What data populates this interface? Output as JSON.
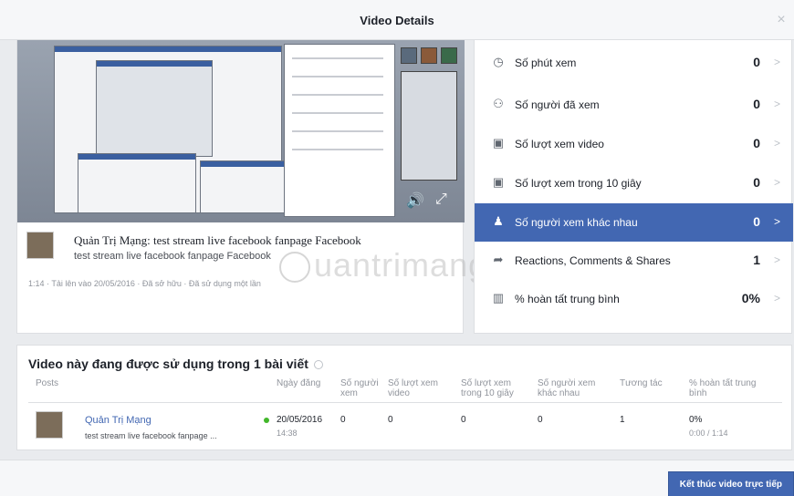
{
  "dialog": {
    "title": "Video Details",
    "close_glyph": "×"
  },
  "video": {
    "title": "Quản Trị Mạng: test stream live facebook fanpage Facebook",
    "description": "test stream live facebook fanpage Facebook",
    "meta": "1:14 · Tải lên vào 20/05/2016 · Đã sở hữu · Đã sử dụng một lần"
  },
  "watermark": "uantrimang",
  "metrics": [
    {
      "icon": "clock-icon",
      "glyph": "◷",
      "label": "Số phút xem",
      "value": "0",
      "active": false
    },
    {
      "icon": "people-icon",
      "glyph": "⚇",
      "label": "Số người đã xem",
      "value": "0",
      "active": false
    },
    {
      "icon": "video-views-icon",
      "glyph": "▣",
      "label": "Số lượt xem video",
      "value": "0",
      "active": false
    },
    {
      "icon": "video-10s-icon",
      "glyph": "▣",
      "label": "Số lượt xem trong 10 giây",
      "value": "0",
      "active": false
    },
    {
      "icon": "person-icon",
      "glyph": "♟",
      "label": "Số người xem khác nhau",
      "value": "0",
      "active": true
    },
    {
      "icon": "share-icon",
      "glyph": "➦",
      "label": "Reactions, Comments & Shares",
      "value": "1",
      "active": false
    },
    {
      "icon": "film-icon",
      "glyph": "▥",
      "label": "% hoàn tất trung bình",
      "value": "0%",
      "active": false
    }
  ],
  "posts": {
    "heading": "Video này đang được sử dụng trong 1 bài viết",
    "columns": [
      "Posts",
      "Ngày đăng",
      "Số người xem",
      "Số lượt xem video",
      "Số lượt xem trong 10 giây",
      "Số người xem khác nhau",
      "Tương tác",
      "% hoàn tất trung bình"
    ],
    "row": {
      "name": "Quản Trị Mạng",
      "text": "test stream live facebook fanpage ...",
      "date": "20/05/2016",
      "time": "14:38",
      "viewers": "0",
      "video_views": "0",
      "views_10s": "0",
      "unique_viewers": "0",
      "engagement": "1",
      "completion": "0%",
      "completion_sub": "0:00 / 1:14"
    }
  },
  "footer": {
    "end_button": "Kết thúc video trực tiếp"
  },
  "colors": {
    "accent": "#4267b2",
    "status_live": "#42b72a"
  }
}
